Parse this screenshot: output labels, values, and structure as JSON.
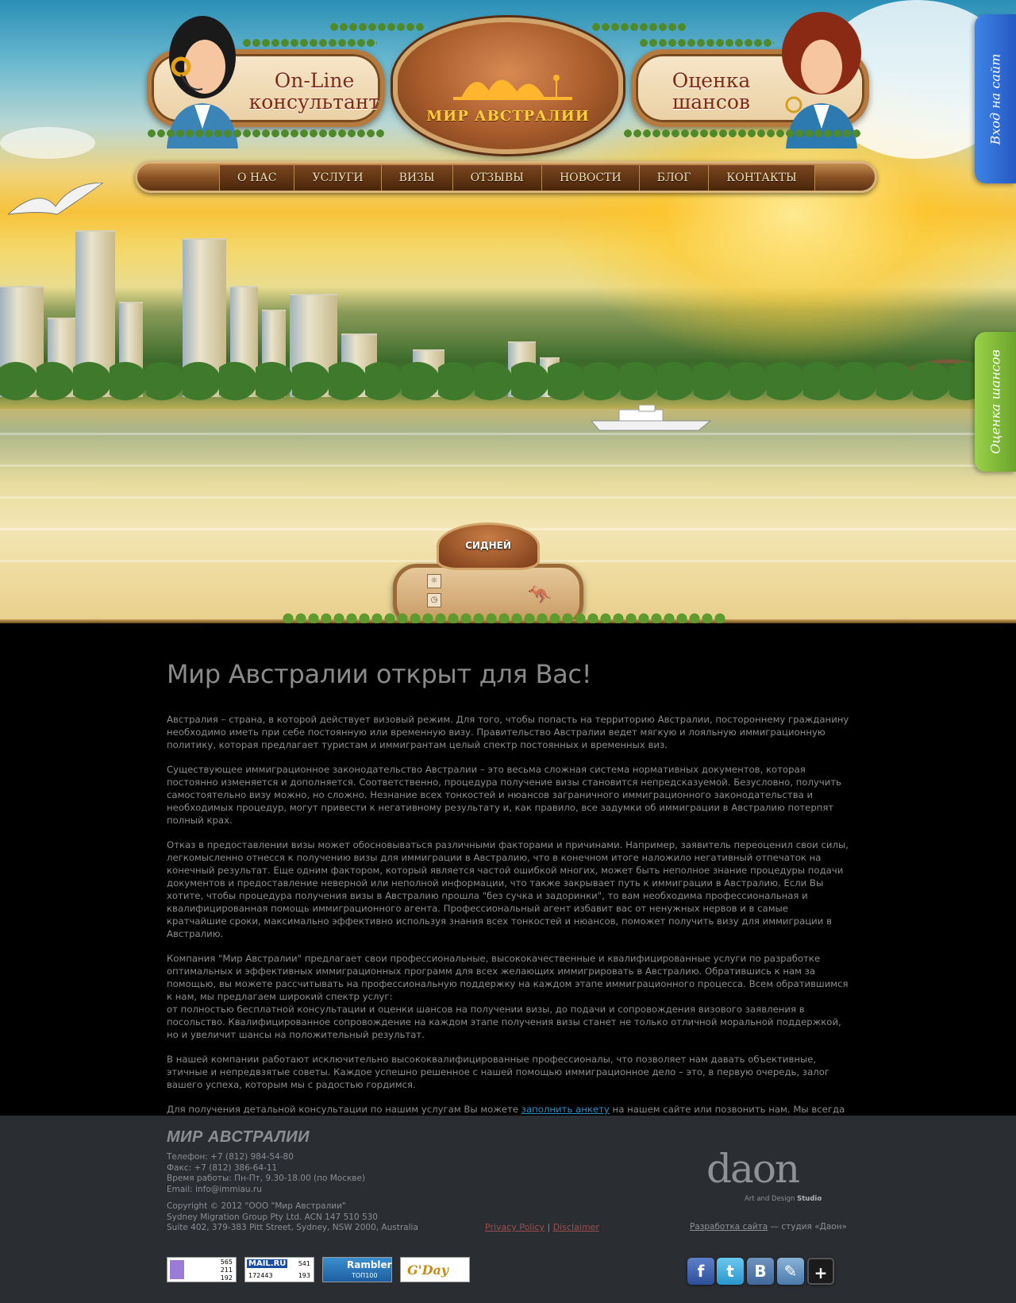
{
  "header": {
    "consultant_title": "On-Line консультант",
    "chances_title": "Оценка шансов",
    "brand": "МИР АВСТРАЛИИ"
  },
  "nav": {
    "items": [
      {
        "label": "О НАС"
      },
      {
        "label": "УСЛУГИ"
      },
      {
        "label": "ВИЗЫ"
      },
      {
        "label": "ОТЗЫВЫ"
      },
      {
        "label": "НОВОСТИ"
      },
      {
        "label": "БЛОГ"
      },
      {
        "label": "КОНТАКТЫ"
      }
    ]
  },
  "side_tabs": {
    "login": "Вход на сайт",
    "chances": "Оценка шансов"
  },
  "plaque": {
    "city": "СИДНЕЙ"
  },
  "main": {
    "title": "Мир Австралии открыт для Вас!",
    "paragraphs": [
      "Австралия – страна, в которой действует визовый режим. Для того, чтобы попасть на территорию Австралии, постороннему гражданину необходимо иметь при себе постоянную или временную визу. Правительство Австралии ведет мягкую и лояльную иммиграционную политику, которая предлагает туристам и иммигрантам целый спектр постоянных и временных виз.",
      "Существующее иммиграционное законодательство Австралии – это весьма сложная система нормативных документов, которая постоянно изменяется и дополняется. Соответственно, процедура получение визы становится непредсказуемой. Безусловно, получить самостоятельно визу можно, но сложно. Незнание всех тонкостей и нюансов заграничного иммиграционного законодательства и необходимых процедур, могут привести к негативному результату и, как правило, все задумки об иммиграции в Австралию потерпят полный крах.",
      "Отказ в предоставлении визы может обосновываться различными факторами и причинами. Например, заявитель переоценил свои силы, легкомысленно отнесся к получению визы для иммиграции в Австралию, что в конечном итоге наложило негативный отпечаток на конечный результат. Еще одним фактором, который является частой ошибкой многих, может быть неполное знание процедуры подачи документов и предоставление неверной или неполной информации, что также закрывает путь к  иммиграции в Австралию. Если Вы хотите, чтобы процедура получения визы в Австралию прошла \"без сучка и задоринки\", то вам необходима профессиональная и квалифицированная помощь иммиграционного агента. Профессиональный агент избавит вас от ненужных нервов и в самые кратчайшие сроки, максимально эффективно используя знания всех тонкостей и нюансов, поможет получить визу для иммиграции в Австралию.",
      "Компания \"Мир Австралии\" предлагает свои профессиональные, высококачественные и квалифицированные услуги по разработке оптимальных и эффективных иммиграционных программ для всех желающих иммигрировать в Австралию. Обратившись к нам за помощью, вы можете рассчитывать на профессиональную поддержку на каждом этапе иммиграционного процесса. Всем обратившимся к нам, мы предлагаем широкий спектр услуг:",
      "от полностью бесплатной консультации и оценки шансов на получении визы, до подачи и сопровождения визового заявления в посольство. Квалифицированное сопровождение на каждом этапе получения визы станет не только отличной моральной поддержкой, но и увеличит шансы на положительный результат.",
      "В нашей компании работают исключительно высококвалифицированные профессионалы, что позволяет нам давать объективные, этичные и непредвзятые советы. Каждое успешно решенное с нашей помощью иммиграционное дело – это, в первую очередь, залог вашего успеха, которым мы с радостью гордимся."
    ],
    "last_before": "Для получения детальной консультации по нашим услугам Вы можете ",
    "last_link": "заполнить анкету",
    "last_after": " на нашем сайте или позвонить нам. Мы всегда рады нашим клиентам!"
  },
  "footer": {
    "logo": "МИР АВСТРАЛИИ",
    "phone": "Телефон: +7 (812) 984-54-80",
    "fax": "Факс: +7 (812) 386-64-11",
    "hours": "Время работы: Пн-Пт, 9.30-18.00 (по Москве)",
    "email": "Email: info@immiau.ru",
    "copyright": "Copyright © 2012 \"ООО \"Мир Австралии\"",
    "company": "Sydney Migration Group Pty Ltd. ACN 147 510 530",
    "address": "Suite 402, 379-383 Pitt Street, Sydney, NSW 2000, Australia",
    "privacy": "Privacy Policy",
    "separator": "|",
    "disclaimer": "Disclaimer",
    "studio_word": "daon",
    "studio_sub": "Art and Design",
    "studio_sub_bold": "Studio",
    "dev_link": "Разработка сайта",
    "dev_rest": " — студия «Даон»",
    "counters": {
      "liveinternet": [
        "565",
        "211",
        "192"
      ],
      "mailru_label": "MAIL.RU",
      "mailru": [
        "541",
        "172443",
        "193"
      ],
      "rambler_label": "Rambler",
      "rambler_sub": "ТОП100",
      "gday_label": "G'Day"
    },
    "social": {
      "facebook": "f",
      "twitter": "t",
      "vkontakte": "B",
      "livejournal": "✎",
      "google_plus": "+"
    }
  },
  "colors": {
    "login_tab": "#2e6ed6",
    "chances_tab": "#86bf3a",
    "content_bg": "#000000",
    "footer_bg": "#2a2d31",
    "link": "#2a8fc4"
  }
}
